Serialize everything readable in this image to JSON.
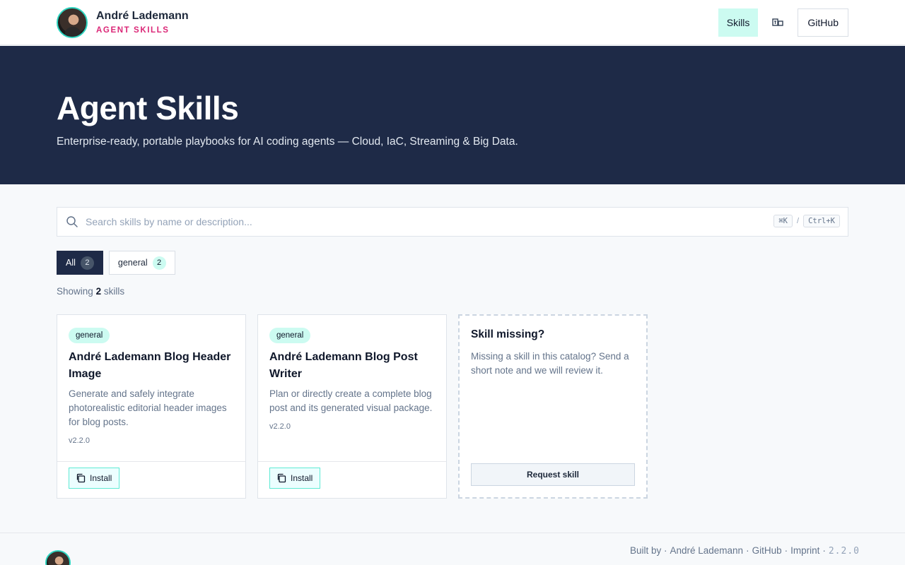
{
  "header": {
    "brand_name": "André Lademann",
    "brand_sub": "AGENT SKILLS",
    "nav_skills": "Skills",
    "nav_github": "GitHub",
    "lang_icon": "translate-icon"
  },
  "hero": {
    "title": "Agent Skills",
    "subtitle": "Enterprise-ready, portable playbooks for AI coding agents — Cloud, IaC, Streaming & Big Data."
  },
  "search": {
    "placeholder": "Search skills by name or description...",
    "shortcut_mac": "⌘K",
    "shortcut_sep": "/",
    "shortcut_win": "Ctrl+K"
  },
  "filters": [
    {
      "label": "All",
      "count": "2",
      "active": true
    },
    {
      "label": "general",
      "count": "2",
      "active": false
    }
  ],
  "showing": {
    "prefix": "Showing",
    "count": "2",
    "suffix": "skills"
  },
  "cards": [
    {
      "tag": "general",
      "title": "André Lademann Blog Header Image",
      "description": "Generate and safely integrate photorealistic editorial header images for blog posts.",
      "version": "v2.2.0",
      "install_label": "Install"
    },
    {
      "tag": "general",
      "title": "André Lademann Blog Post Writer",
      "description": "Plan or directly create a complete blog post and its generated visual package.",
      "version": "v2.2.0",
      "install_label": "Install"
    }
  ],
  "missing": {
    "title": "Skill missing?",
    "description": "Missing a skill in this catalog? Send a short note and we will review it.",
    "button": "Request skill"
  },
  "footer": {
    "built_by": "Built by ·",
    "author": "André Lademann",
    "github": "GitHub",
    "imprint": "Imprint",
    "version": "2.2.0"
  }
}
